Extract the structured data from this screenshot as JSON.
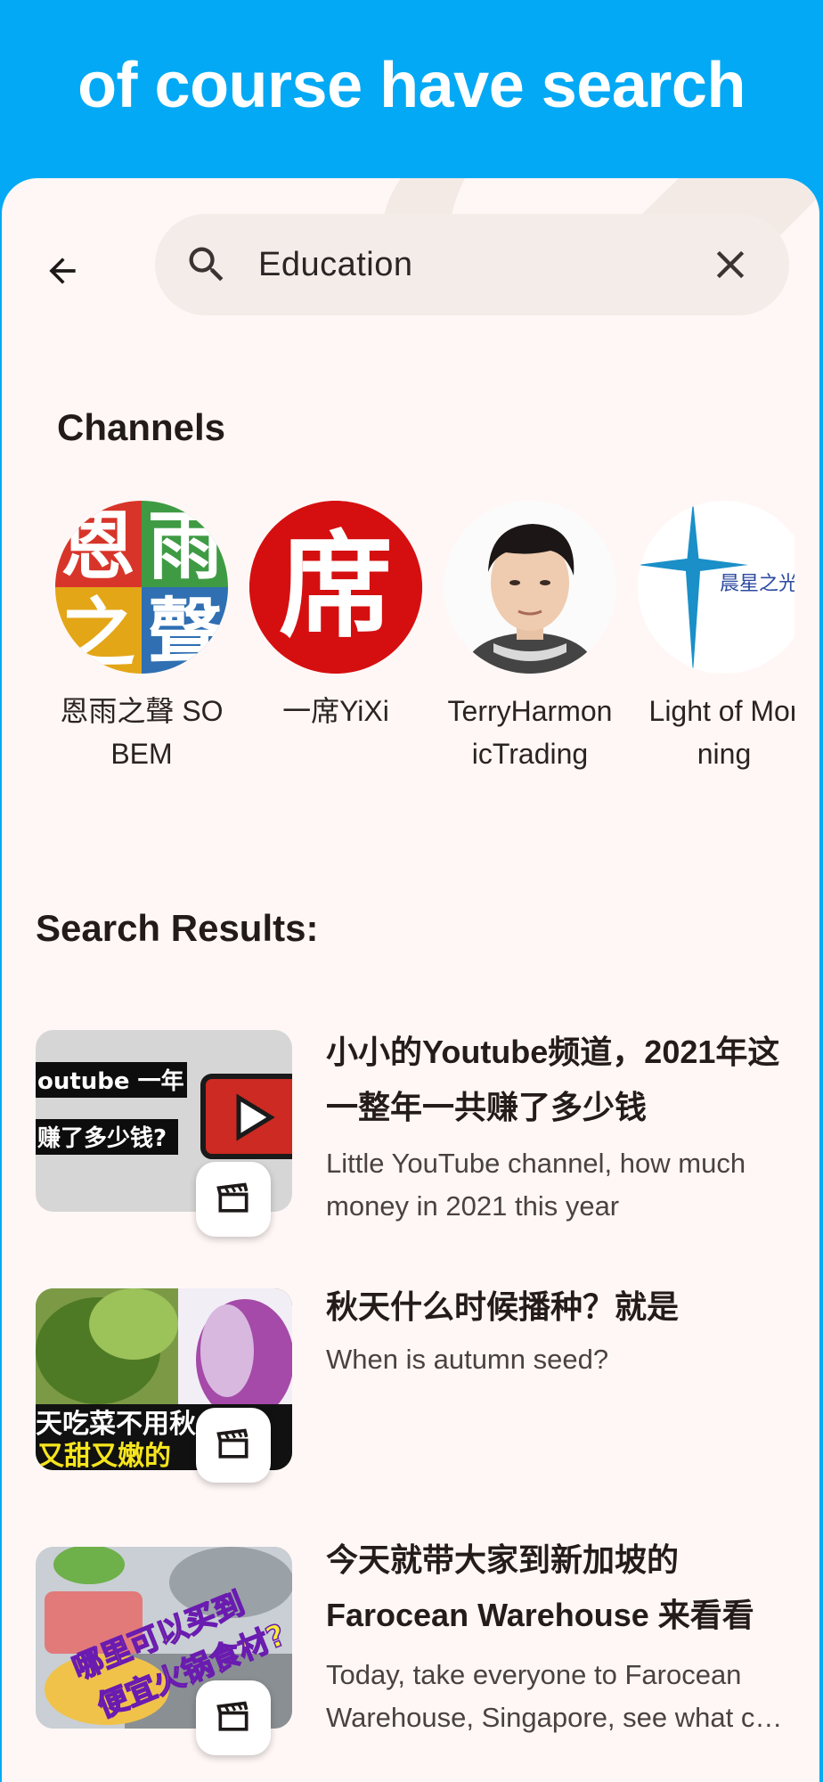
{
  "banner": {
    "title": "of course have search"
  },
  "search": {
    "query": "Education",
    "back_icon": "arrow-left-icon",
    "search_icon": "search-icon",
    "clear_icon": "close-icon"
  },
  "channels": {
    "title": "Channels",
    "items": [
      {
        "name": "恩雨之聲 SOBEM",
        "logo_text": [
          "恩",
          "雨",
          "之",
          "聲"
        ]
      },
      {
        "name": "一席YiXi",
        "logo_text": "席"
      },
      {
        "name": "TerryHarmonicTrading"
      },
      {
        "name": "Light of Morning",
        "logo_text": "晨星之光"
      }
    ]
  },
  "results": {
    "title": "Search Results:",
    "items": [
      {
        "title": "小小的Youtube频道，2021年这一整年一共赚了多少钱",
        "description": "Little YouTube channel, how much money in 2021 this year",
        "thumb_text": [
          "outube 一年",
          "赚了多少钱?"
        ]
      },
      {
        "title": "秋天什么时候播种？就是",
        "description": "When is autumn seed?",
        "thumb_text": [
          "天吃菜不用秋",
          "又甜又嫩的"
        ]
      },
      {
        "title": "今天就带大家到新加坡的Farocean Warehouse 来看看",
        "description": "Today, take everyone to Farocean Warehouse, Singapore, see what can buy",
        "thumb_text": [
          "哪里可以买到",
          "便宜火锅食材?"
        ]
      }
    ]
  },
  "colors": {
    "banner": "#03A9F4",
    "surface": "#FFF7F5",
    "search_bg": "#F3ECE9"
  }
}
